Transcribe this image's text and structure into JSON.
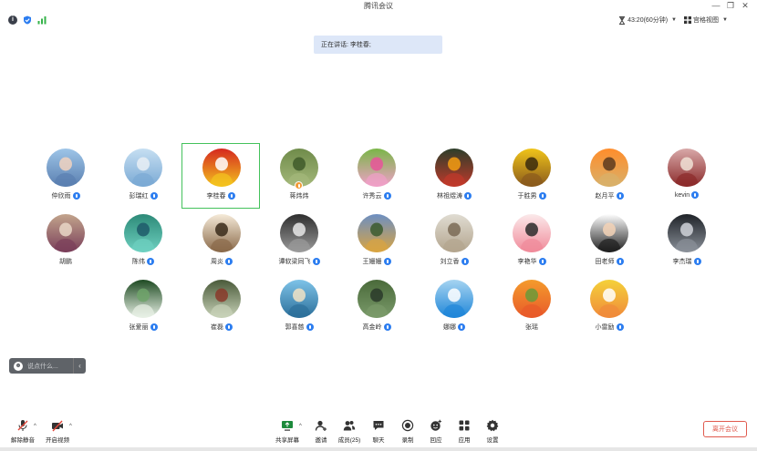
{
  "window": {
    "title": "腾讯会议",
    "minimize_glyph": "—",
    "restore_glyph": "❐",
    "close_glyph": "✕"
  },
  "topbar": {
    "timer_text": "43:20(60分钟)",
    "view_text": "宫格视图",
    "icons": {
      "info": "info-icon",
      "security": "shield-icon",
      "network": "signal-icon",
      "timer": "hourglass-icon",
      "view": "grid-icon"
    }
  },
  "speaking": {
    "text": "正在讲话: 李桂春;"
  },
  "participants": [
    {
      "name": "仲欣雨",
      "mic": true
    },
    {
      "name": "彭瑞红",
      "mic": true
    },
    {
      "name": "李桂春",
      "mic": true,
      "active": true
    },
    {
      "name": "蒋炜炜",
      "mic": false,
      "badge": true
    },
    {
      "name": "许秀云",
      "mic": true
    },
    {
      "name": "林祖煜涛",
      "mic": true
    },
    {
      "name": "于胜男",
      "mic": true
    },
    {
      "name": "赵月平",
      "mic": true
    },
    {
      "name": "kevin",
      "mic": true
    },
    {
      "name": "胡鹏",
      "mic": false
    },
    {
      "name": "陈伟",
      "mic": true
    },
    {
      "name": "周炎",
      "mic": true
    },
    {
      "name": "谭软梁同飞",
      "mic": true
    },
    {
      "name": "王姗姗",
      "mic": true
    },
    {
      "name": "刘立香",
      "mic": true
    },
    {
      "name": "李艳华",
      "mic": true
    },
    {
      "name": "田老师",
      "mic": true
    },
    {
      "name": "李杰瑞",
      "mic": true
    },
    {
      "name": "张爱丽",
      "mic": true
    },
    {
      "name": "崔磊",
      "mic": true
    },
    {
      "name": "郭喜慈",
      "mic": true
    },
    {
      "name": "高金岭",
      "mic": true
    },
    {
      "name": "娜娜",
      "mic": true
    },
    {
      "name": "张瑶",
      "mic": false
    },
    {
      "name": "小雷励",
      "mic": true
    }
  ],
  "chat": {
    "placeholder": "说点什么...",
    "collapse_glyph": "‹"
  },
  "toolbar": {
    "unmute": "解除静音",
    "start_video": "开启视频",
    "share": "共享屏幕",
    "invite": "邀请",
    "members": "成员(25)",
    "chat": "聊天",
    "record": "录制",
    "react": "回应",
    "apps": "应用",
    "settings": "设置",
    "leave": "离开会议",
    "chevron_glyph": "^"
  },
  "colors": {
    "accent": "#2c7df0",
    "active_border": "#43c25b",
    "leave": "#e05a4e",
    "speaking_bg": "#dde7f8"
  }
}
